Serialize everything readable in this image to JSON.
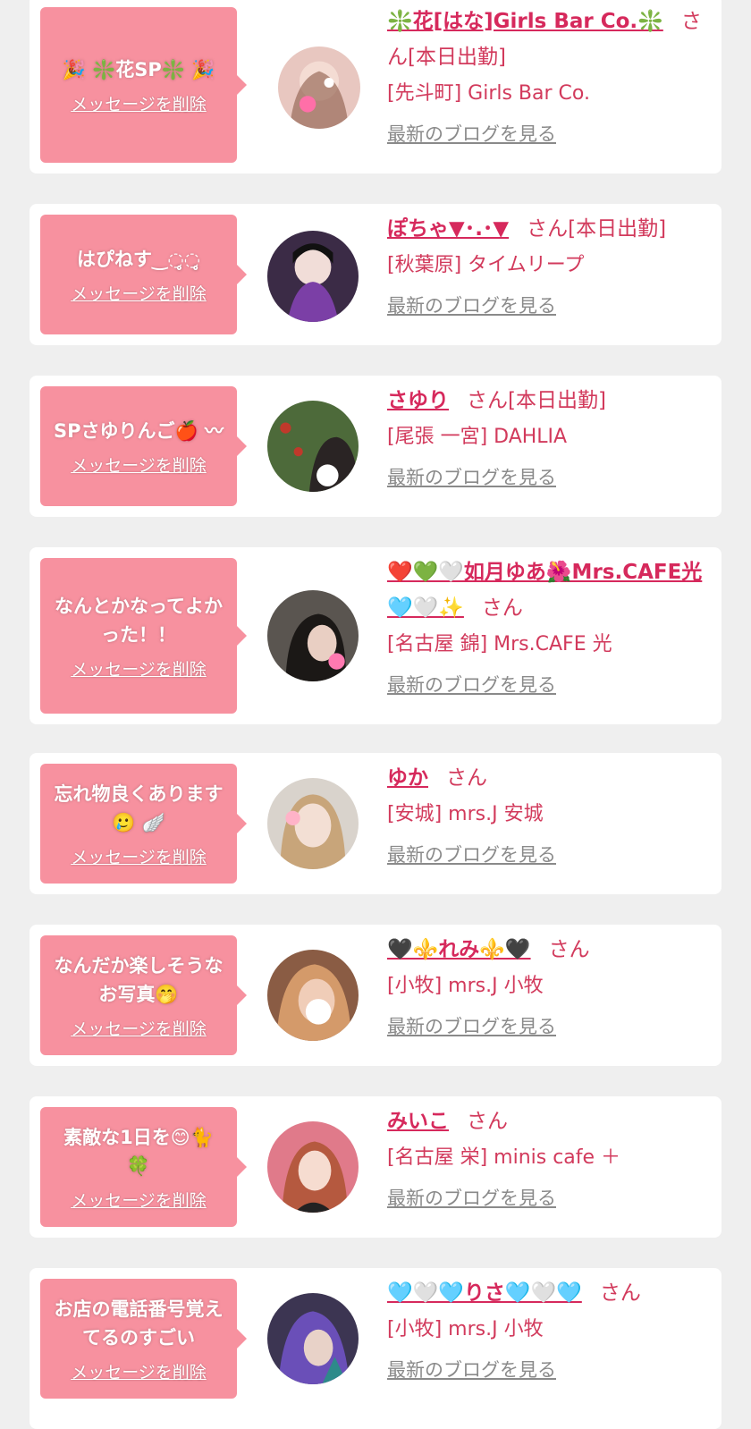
{
  "accent": "#d6295c",
  "bubble_color": "#f7919f",
  "items": [
    {
      "message": "🎉 ❇️花SP❇️ 🎉",
      "delete_label": "メッセージを削除",
      "girl_name": "❇️花[はな]Girls Bar Co.❇️",
      "suffix": "さん[本日出勤]",
      "shop": "[先斗町] Girls Bar Co.",
      "blog_label": "最新のブログを見る"
    },
    {
      "message": "はぴねす‿◌̥̥◌̥̥",
      "delete_label": "メッセージを削除",
      "girl_name": "ぽちゃ▼･.･▼",
      "suffix": "さん[本日出勤]",
      "shop": "[秋葉原] タイムリープ",
      "blog_label": "最新のブログを見る"
    },
    {
      "message": "SPさゆりんご🍎 〰",
      "delete_label": "メッセージを削除",
      "girl_name": "さゆり",
      "suffix": "さん[本日出勤]",
      "shop": "[尾張 一宮] DAHLIA",
      "blog_label": "最新のブログを見る"
    },
    {
      "message": "なんとかなってよかった！！",
      "delete_label": "メッセージを削除",
      "girl_name": "❤️💚🤍如月ゆあ🌺Mrs.CAFE光🩵🤍✨",
      "suffix": "さん",
      "shop": "[名古屋 錦] Mrs.CAFE 光",
      "blog_label": "最新のブログを見る"
    },
    {
      "message": "忘れ物良くあります🥲 🪽",
      "delete_label": "メッセージを削除",
      "girl_name": "ゆか",
      "suffix": "さん",
      "shop": "[安城] mrs.J 安城",
      "blog_label": "最新のブログを見る"
    },
    {
      "message": "なんだか楽しそうなお写真🤭",
      "delete_label": "メッセージを削除",
      "girl_name": "🖤⚜️れみ⚜️🖤",
      "suffix": "さん",
      "shop": "[小牧] mrs.J 小牧",
      "blog_label": "最新のブログを見る"
    },
    {
      "message": "素敵な1日を😊🐈 🍀",
      "delete_label": "メッセージを削除",
      "girl_name": "みいこ",
      "suffix": "さん",
      "shop": "[名古屋 栄] minis cafe ＋",
      "blog_label": "最新のブログを見る"
    },
    {
      "message": "お店の電話番号覚えてるのすごい",
      "delete_label": "メッセージを削除",
      "girl_name": "🩵🤍🩵りさ🩵🤍🩵",
      "suffix": "さん",
      "shop": "[小牧] mrs.J 小牧",
      "blog_label": "最新のブログを見る"
    }
  ]
}
